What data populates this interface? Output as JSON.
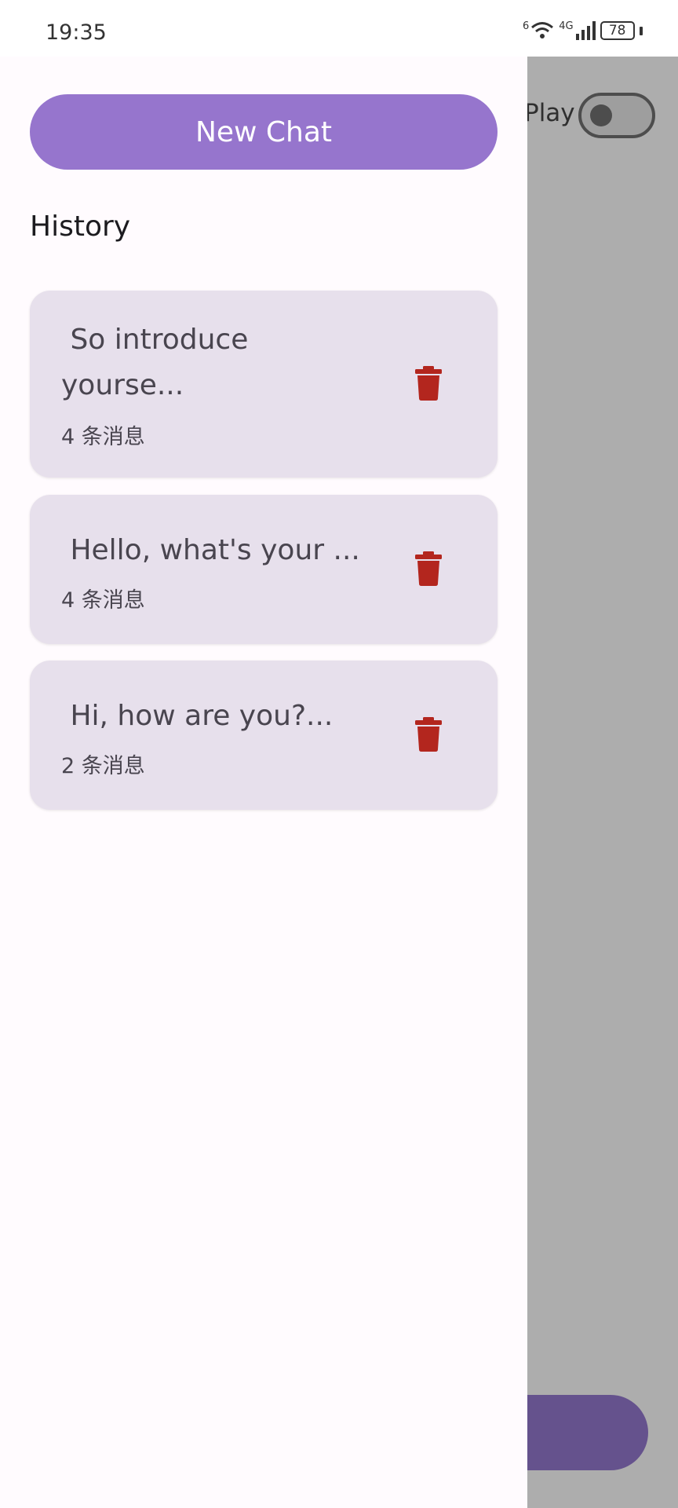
{
  "status_bar": {
    "time": "19:35",
    "battery": "78",
    "wifi_badge": "6",
    "network_label": "4G"
  },
  "background_screen": {
    "play_label": "Play",
    "play_switch_on": false
  },
  "drawer": {
    "new_chat_label": "New Chat",
    "history_title": "History",
    "chats": [
      {
        "title": " So introduce\nyourse...",
        "count": "4 条消息"
      },
      {
        "title": " Hello, what's your ...",
        "count": "4 条消息"
      },
      {
        "title": " Hi, how are you?...",
        "count": "2 条消息"
      }
    ]
  },
  "colors": {
    "accent": "#9675cd",
    "card_bg": "#e7e0ec",
    "delete_icon": "#b3261e",
    "scrim": "#adadad",
    "fab": "#65528d"
  },
  "icons": {
    "delete": "trash-icon",
    "wifi": "wifi-icon",
    "signal": "cell-signal-icon",
    "battery": "battery-icon"
  }
}
